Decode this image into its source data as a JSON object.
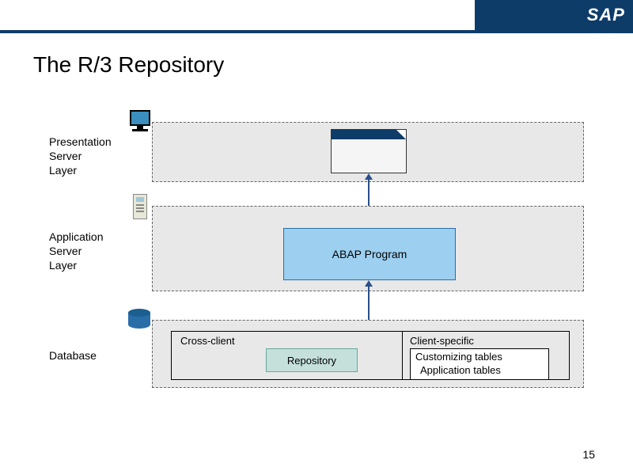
{
  "header": {
    "logo": "SAP"
  },
  "title": "The R/3 Repository",
  "layers": {
    "presentation": "Presentation\nServer\nLayer",
    "application": "Application\nServer\nLayer",
    "database": "Database"
  },
  "abap": "ABAP Program",
  "db": {
    "cross_client": "Cross-client",
    "repository": "Repository",
    "client_specific": "Client-specific",
    "customizing": "Customizing tables",
    "application_tables": "Application tables"
  },
  "page_number": "15"
}
